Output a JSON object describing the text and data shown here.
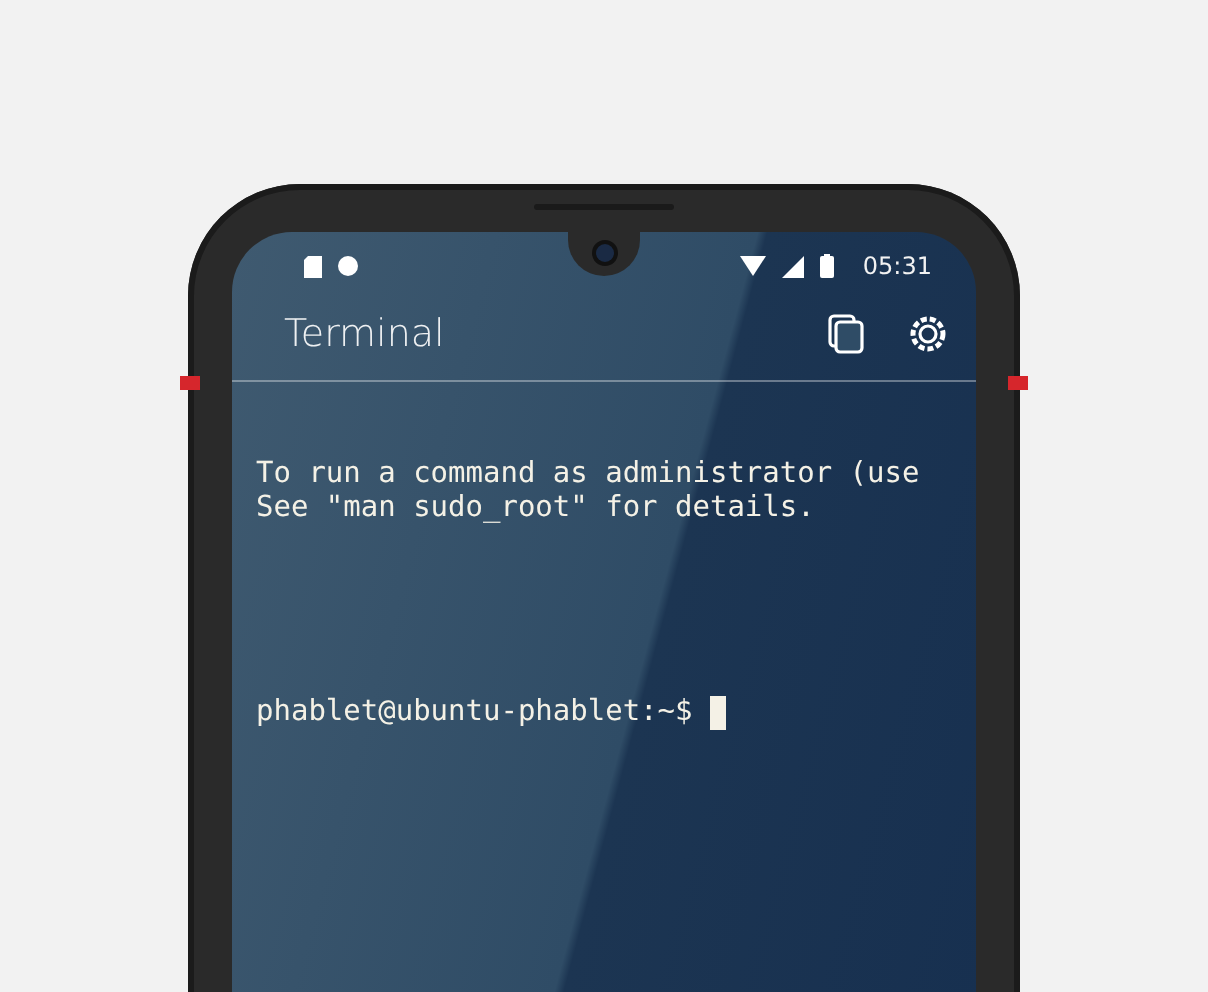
{
  "status_bar": {
    "time": "05:31"
  },
  "header": {
    "title": "Terminal"
  },
  "terminal": {
    "output_lines": [
      "To run a command as administrator (use",
      "See \"man sudo_root\" for details."
    ],
    "prompt": "phablet@ubuntu-phablet:~$"
  }
}
